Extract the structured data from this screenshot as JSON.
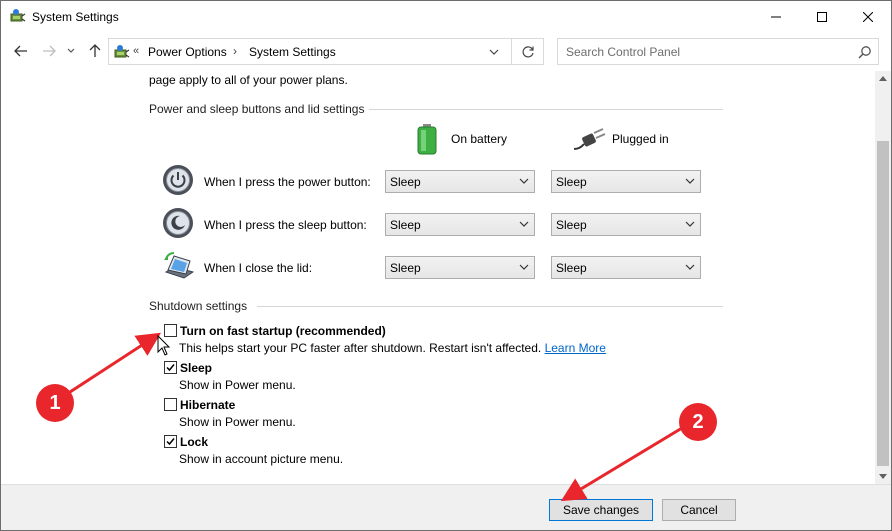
{
  "window": {
    "title": "System Settings"
  },
  "address": {
    "chevron": "«",
    "crumbs": [
      "Power Options",
      "System Settings"
    ],
    "separator": "›",
    "search_placeholder": "Search Control Panel"
  },
  "content": {
    "intro": "page apply to all of your power plans.",
    "buttons_group": {
      "heading": "Power and sleep buttons and lid settings",
      "columns": [
        "On battery",
        "Plugged in"
      ],
      "rows": [
        {
          "label": "When I press the power button:",
          "battery": "Sleep",
          "plugged": "Sleep"
        },
        {
          "label": "When I press the sleep button:",
          "battery": "Sleep",
          "plugged": "Sleep"
        },
        {
          "label": "When I close the lid:",
          "battery": "Sleep",
          "plugged": "Sleep"
        }
      ]
    },
    "shutdown_group": {
      "heading": "Shutdown settings",
      "options": [
        {
          "title": "Turn on fast startup (recommended)",
          "desc": "This helps start your PC faster after shutdown. Restart isn't affected.",
          "link": "Learn More",
          "checked": false
        },
        {
          "title": "Sleep",
          "desc": "Show in Power menu.",
          "checked": true
        },
        {
          "title": "Hibernate",
          "desc": "Show in Power menu.",
          "checked": false
        },
        {
          "title": "Lock",
          "desc": "Show in account picture menu.",
          "checked": true
        }
      ]
    }
  },
  "footer": {
    "save_label": "Save changes",
    "cancel_label": "Cancel"
  },
  "annotations": {
    "badge1": "1",
    "badge2": "2",
    "color": "#e8262b"
  },
  "icons": {
    "app": "power-options-icon",
    "battery": "battery-icon",
    "plug": "plug-icon",
    "power_button": "power-button-icon",
    "sleep_button": "sleep-button-icon",
    "lid": "laptop-lid-icon"
  }
}
